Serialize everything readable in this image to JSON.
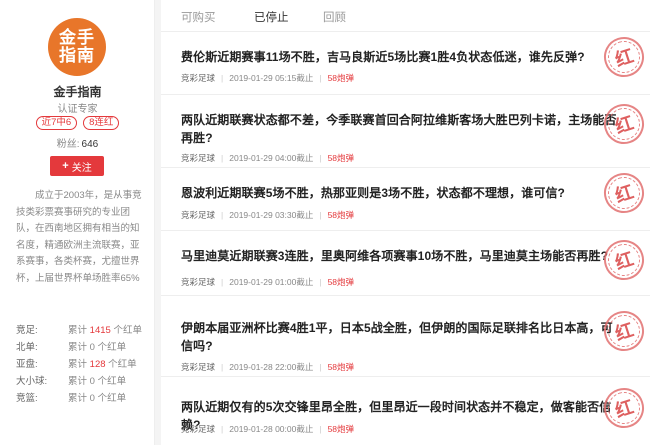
{
  "expert": {
    "logo_line1": "金手",
    "logo_line2": "指南",
    "name": "金手指南",
    "role": "认证专家",
    "badge_recent": "近7中6",
    "badge_streak": "8连红",
    "fans_label": "粉丝:",
    "fans_count": "646",
    "follow_label": "关注",
    "bio": "成立于2003年，是从事竞技类彩票赛事研究的专业团队，在西南地区拥有相当的知名度，精通欧洲主流联赛，亚系赛事，各类杯赛，尤擅世界杯，上届世界杯单场胜率65%"
  },
  "stats": [
    {
      "label": "竞足:",
      "prefix": "累计",
      "num": "1415",
      "suffix": "个红单"
    },
    {
      "label": "北单:",
      "prefix": "累计",
      "num": "0",
      "suffix": "个红单"
    },
    {
      "label": "亚盘:",
      "prefix": "累计",
      "num": "128",
      "suffix": "个红单"
    },
    {
      "label": "大小球:",
      "prefix": "累计",
      "num": "0",
      "suffix": "个红单"
    },
    {
      "label": "竞篮:",
      "prefix": "累计",
      "num": "0",
      "suffix": "个红单"
    }
  ],
  "tabs": [
    {
      "label": "可购买"
    },
    {
      "label": "已停止"
    },
    {
      "label": "回顾"
    }
  ],
  "stamp_text": "红",
  "articles": [
    {
      "title": "费伦斯近期赛事11场不胜，吉马良斯近5场比赛1胜4负状态低迷，谁先反弹?",
      "category": "竞彩足球",
      "datetime": "2019-01-29 05:15截止",
      "price": "58炮弹"
    },
    {
      "title": "两队近期联赛状态都不差，今季联赛首回合阿拉维斯客场大胜巴列卡诺，主场能否再胜?",
      "category": "竞彩足球",
      "datetime": "2019-01-29 04:00截止",
      "price": "58炮弹"
    },
    {
      "title": "恩波利近期联赛5场不胜，热那亚则是3场不胜，状态都不理想，谁可信?",
      "category": "竞彩足球",
      "datetime": "2019-01-29 03:30截止",
      "price": "58炮弹"
    },
    {
      "title": "马里迪莫近期联赛3连胜，里奥阿维各项赛事10场不胜，马里迪莫主场能否再胜?",
      "category": "竞彩足球",
      "datetime": "2019-01-29 01:00截止",
      "price": "58炮弹"
    },
    {
      "title": "伊朗本届亚洲杯比赛4胜1平，日本5战全胜，但伊朗的国际足联排名比日本高，可信吗?",
      "category": "竞彩足球",
      "datetime": "2019-01-28 22:00截止",
      "price": "58炮弹"
    },
    {
      "title": "两队近期仅有的5次交锋里昂全胜，但里昂近一段时间状态并不稳定，做客能否信赖?",
      "category": "竞彩足球",
      "datetime": "2019-01-28 00:00截止",
      "price": "58炮弹"
    }
  ]
}
